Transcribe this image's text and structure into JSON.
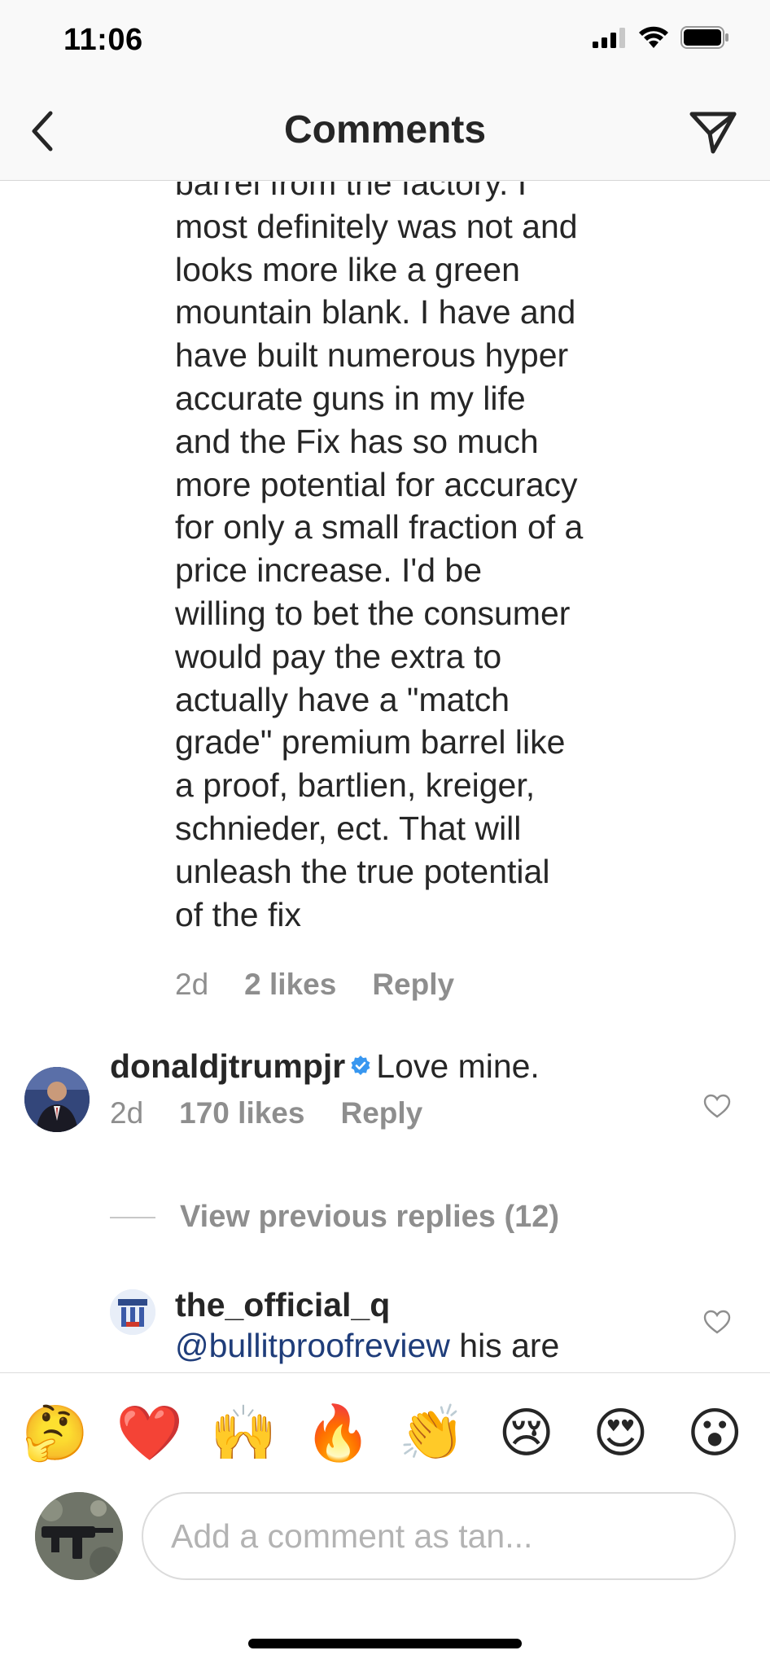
{
  "status": {
    "time": "11:06"
  },
  "header": {
    "title": "Comments"
  },
  "comment_continuation": {
    "text": "barrel from the factory.  I\nmost definitely was not and\nlooks more like a green\nmountain blank.  I have and\nhave built numerous hyper\naccurate guns in my life\nand the Fix has so much\nmore potential for accuracy\nfor only a small fraction of a\nprice increase.  I'd be\nwilling to bet the consumer\nwould pay the extra to\nactually have a \"match\ngrade\" premium barrel like\na proof, bartlien, kreiger,\nschnieder, ect. That will\nunleash the true potential\nof the fix",
    "time": "2d",
    "likes": "2 likes",
    "reply_label": "Reply"
  },
  "comment_trump": {
    "username": "donaldjtrumpjr",
    "text": "Love mine.",
    "time": "2d",
    "likes": "170 likes",
    "reply_label": "Reply"
  },
  "view_previous": "View previous replies (12)",
  "reply_q": {
    "username": "the_official_q",
    "mention": "@bullitproofreview",
    "text": " his are"
  },
  "emoji_bar": [
    "🤔",
    "❤️",
    "🙌",
    "🔥",
    "👏",
    "😢",
    "😍",
    "😮"
  ],
  "composer": {
    "placeholder": "Add a comment as tan..."
  },
  "colors": {
    "secondary_text": "#8e8e8e",
    "mention": "#1f3d7a",
    "verified": "#3897f0"
  }
}
